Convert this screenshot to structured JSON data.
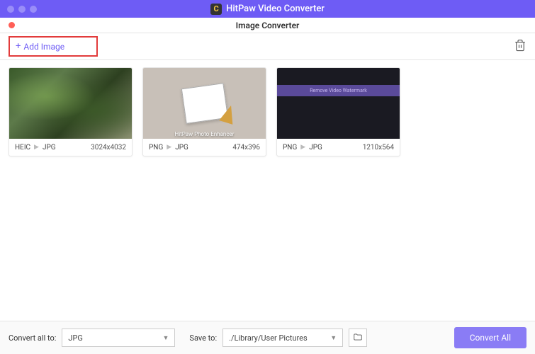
{
  "titleBar": {
    "appName": "HitPaw Video Converter"
  },
  "subHeader": {
    "title": "Image Converter"
  },
  "toolbar": {
    "addImageLabel": "Add Image"
  },
  "cards": [
    {
      "fromFormat": "HEIC",
      "toFormat": "JPG",
      "dimensions": "3024x4032"
    },
    {
      "fromFormat": "PNG",
      "toFormat": "JPG",
      "dimensions": "474x396",
      "overlayText": "HitPaw Photo Enhancer"
    },
    {
      "fromFormat": "PNG",
      "toFormat": "JPG",
      "dimensions": "1210x564",
      "bannerText": "Remove Video Watermark"
    }
  ],
  "bottomBar": {
    "convertAllLabel": "Convert all to:",
    "formatValue": "JPG",
    "saveToLabel": "Save to:",
    "savePath": "./Library/User Pictures",
    "convertAllButton": "Convert All"
  }
}
